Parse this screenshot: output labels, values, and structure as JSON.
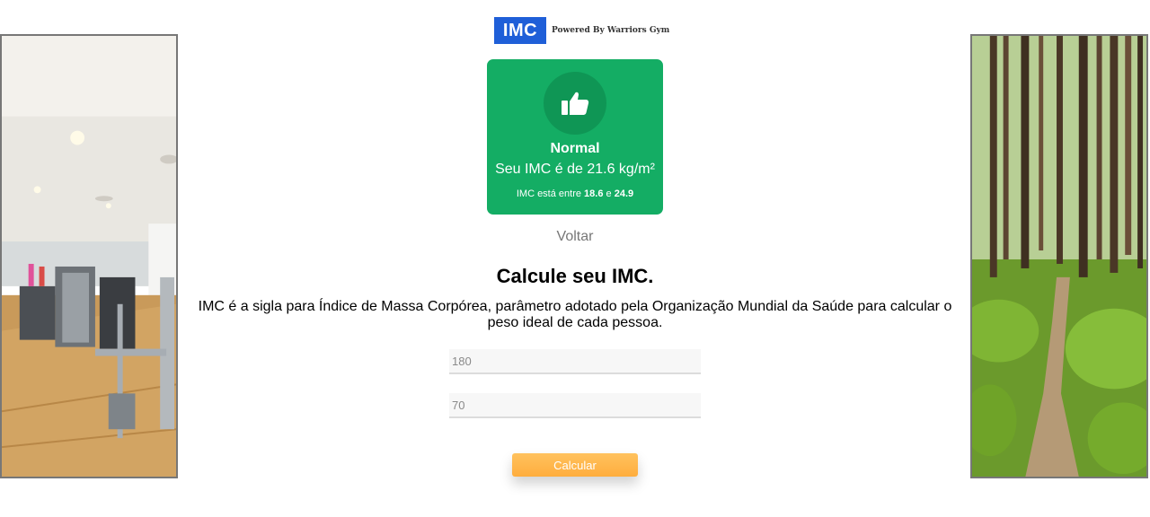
{
  "logo": {
    "badge": "IMC",
    "tagline": "Powered By Warriors Gym"
  },
  "result": {
    "status": "Normal",
    "value_text": "Seu IMC é de 21.6 kg/m²",
    "range_prefix": "IMC está entre",
    "range_min": "18.6",
    "range_conj": "e",
    "range_max": "24.9",
    "color": "#14ad64",
    "icon": "thumbs-up-icon"
  },
  "back_label": "Voltar",
  "heading": "Calcule seu IMC.",
  "description": "IMC é a sigla para Índice de Massa Corpórea, parâmetro adotado pela Organização Mundial da Saúde para calcular o peso ideal de cada pessoa.",
  "form": {
    "height_placeholder": "180",
    "weight_placeholder": "70",
    "submit_label": "Calcular",
    "accent": "#ffad3d"
  }
}
